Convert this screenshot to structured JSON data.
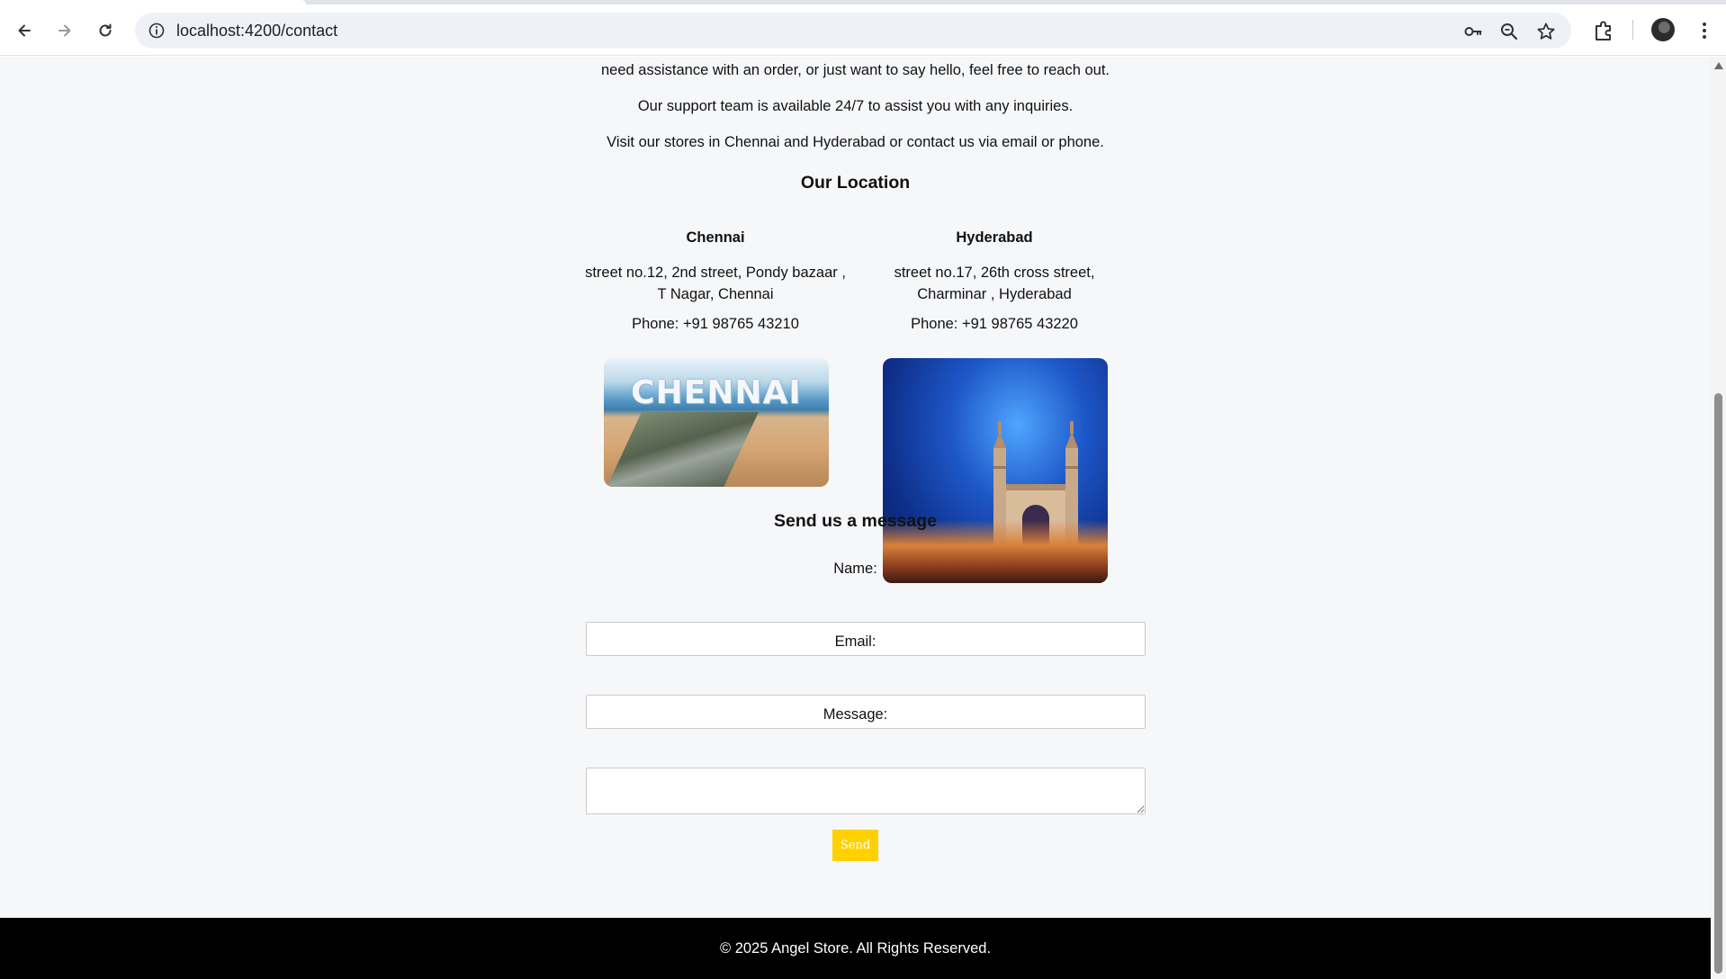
{
  "browser": {
    "url": "localhost:4200/contact",
    "icons": {
      "back": "back-arrow-icon",
      "forward": "forward-arrow-icon",
      "reload": "reload-icon",
      "site_info": "site-info-icon",
      "passwords": "key-icon",
      "zoom": "zoom-icon",
      "bookmark": "star-icon",
      "extensions": "puzzle-icon",
      "profile": "avatar",
      "menu": "kebab-menu-icon"
    }
  },
  "intro": {
    "line1": "need assistance with an order, or just want to say hello, feel free to reach out.",
    "line2": "Our support team is available 24/7 to assist you with any inquiries.",
    "line3": "Visit our stores in Chennai and Hyderabad or contact us via email or phone."
  },
  "locations": {
    "title": "Our Location",
    "items": [
      {
        "city": "Chennai",
        "address": "street no.12, 2nd street, Pondy bazaar , T Nagar, Chennai",
        "phone": "Phone: +91 98765 43210",
        "image_text": "CHENNAI"
      },
      {
        "city": "Hyderabad",
        "address": "street no.17, 26th cross street, Charminar , Hyderabad",
        "phone": "Phone: +91 98765 43220"
      }
    ]
  },
  "form": {
    "title": "Send us a message",
    "name_label": "Name:",
    "email_label": "Email:",
    "message_label": "Message:",
    "name_value": "",
    "email_value": "",
    "message_value": "",
    "send_label": "Send"
  },
  "footer": {
    "text": "© 2025 Angel Store. All Rights Reserved."
  },
  "colors": {
    "page_bg": "#f6f7f9",
    "send_button": "#ffd100",
    "footer_bg": "#000000"
  }
}
